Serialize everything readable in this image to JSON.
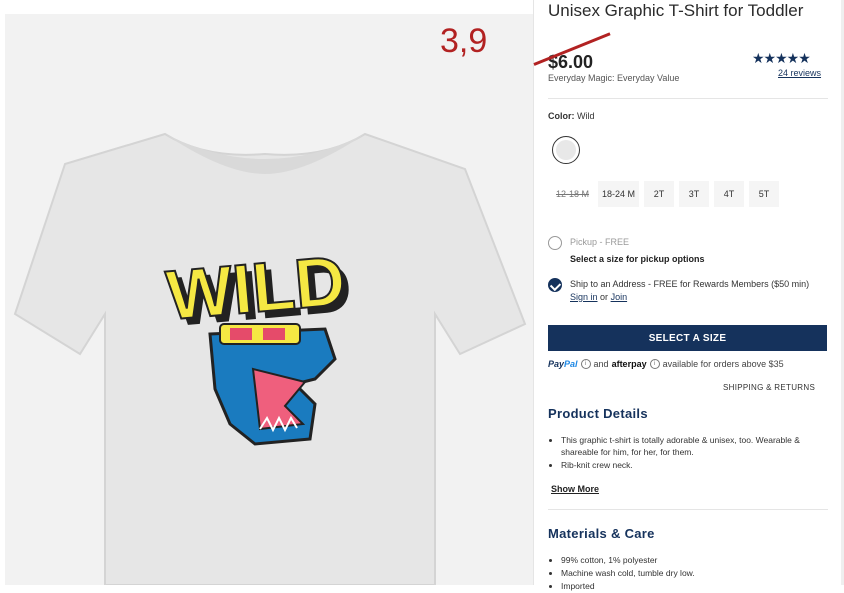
{
  "overlay": {
    "annotation": "3,9"
  },
  "product": {
    "title": "Unisex Graphic T-Shirt for Toddler",
    "price": "$6.00",
    "value_text": "Everyday Magic: Everyday Value",
    "stars": "★★★★★",
    "reviews": "24 reviews",
    "color_label": "Color:",
    "color_value": "Wild",
    "graphic_text": "WILD"
  },
  "sizes": [
    {
      "label": "12-18 M",
      "state": "unavailable"
    },
    {
      "label": "18-24 M",
      "state": "available"
    },
    {
      "label": "2T",
      "state": "available"
    },
    {
      "label": "3T",
      "state": "available"
    },
    {
      "label": "4T",
      "state": "available"
    },
    {
      "label": "5T",
      "state": "available"
    }
  ],
  "fulfillment": {
    "pickup_label": "Pickup - FREE",
    "pickup_note": "Select a size for pickup options",
    "ship_label": "Ship to an Address - FREE for Rewards Members ($50 min)",
    "sign_in": "Sign in",
    "or": "or",
    "join": "Join"
  },
  "cta": {
    "label": "SELECT A SIZE"
  },
  "payment": {
    "paypal_pay": "Pay",
    "paypal_pal": "Pal",
    "and": "and",
    "afterpay": "afterpay",
    "availability": "available for orders above $35"
  },
  "shipping_returns": "SHIPPING & RETURNS",
  "details": {
    "title": "Product Details",
    "items": [
      "This graphic t-shirt is totally adorable & unisex, too. Wearable & shareable for him, for her, for them.",
      "Rib-knit crew neck."
    ],
    "show_more": "Show More"
  },
  "materials": {
    "title": "Materials & Care",
    "items": [
      "99% cotton, 1% polyester",
      "Machine wash cold, tumble dry low.",
      "Imported"
    ]
  },
  "colors": {
    "brand_navy": "#15325c",
    "annotation_red": "#b22222",
    "shirt_gray": "#e6e6e6",
    "graphic_yellow": "#f5e843",
    "dino_blue": "#1a7bbf",
    "mouth_pink": "#ef5f7d"
  }
}
